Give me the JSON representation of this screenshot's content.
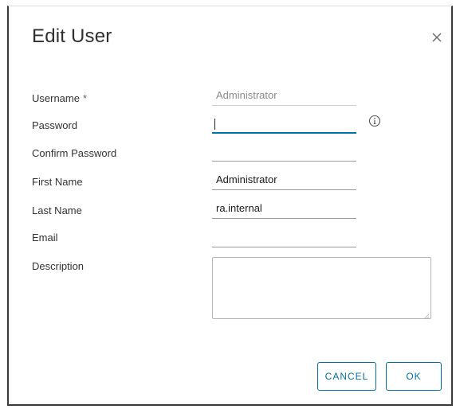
{
  "dialog": {
    "title": "Edit User",
    "close_icon": "close-icon"
  },
  "form": {
    "username": {
      "label": "Username",
      "required_mark": "*",
      "value": "Administrator"
    },
    "password": {
      "label": "Password",
      "value": "",
      "info_icon": "info-icon"
    },
    "confirm_password": {
      "label": "Confirm Password",
      "value": ""
    },
    "first_name": {
      "label": "First Name",
      "value": "Administrator"
    },
    "last_name": {
      "label": "Last Name",
      "value": "ra.internal"
    },
    "email": {
      "label": "Email",
      "value": ""
    },
    "description": {
      "label": "Description",
      "value": ""
    }
  },
  "actions": {
    "cancel_label": "CANCEL",
    "ok_label": "OK"
  },
  "colors": {
    "accent": "#0072a3",
    "border": "#3a3a3a"
  }
}
